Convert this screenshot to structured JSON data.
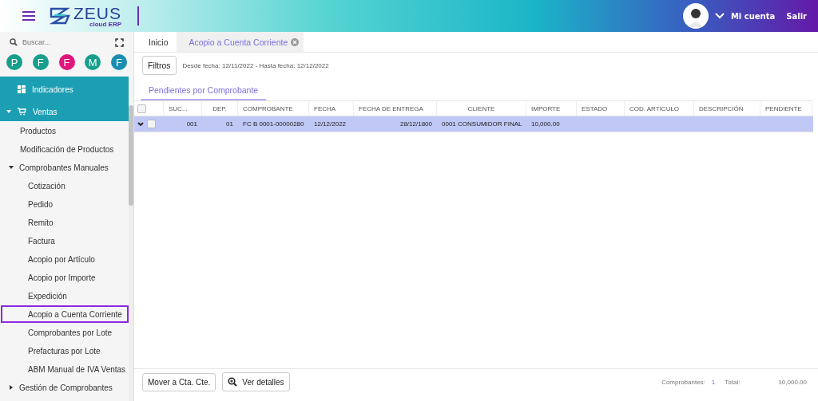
{
  "header": {
    "logo_title": "ZEUS",
    "logo_subtitle": "cloud ERP",
    "account": "Mi cuenta",
    "logout": "Salir"
  },
  "sidebar": {
    "search": {
      "placeholder": "Buscar..."
    },
    "shortcuts": [
      {
        "letter": "P",
        "color": "#179e8c"
      },
      {
        "letter": "F",
        "color": "#179e8c"
      },
      {
        "letter": "F",
        "color": "#e0177d"
      },
      {
        "letter": "M",
        "color": "#179e8c"
      },
      {
        "letter": "F",
        "color": "#1a8db0"
      }
    ],
    "items": [
      {
        "label": "Indicadores",
        "kind": "grid",
        "selected": false
      },
      {
        "label": "Ventas",
        "kind": "cart",
        "expanded": true,
        "selected": false,
        "children": [
          {
            "label": "Productos",
            "selected": false
          },
          {
            "label": "Modificación de Productos",
            "selected": false
          },
          {
            "label": "Comprobantes Manuales",
            "expanded": true,
            "selected": false,
            "children": [
              {
                "label": "Cotización",
                "selected": false
              },
              {
                "label": "Pedido",
                "selected": false
              },
              {
                "label": "Remito",
                "selected": false
              },
              {
                "label": "Factura",
                "selected": false
              },
              {
                "label": "Acopio por Artículo",
                "selected": false
              },
              {
                "label": "Acopio por Importe",
                "selected": false
              },
              {
                "label": "Expedición",
                "selected": false
              },
              {
                "label": "Acopio a Cuenta Corriente",
                "selected": true
              },
              {
                "label": "Comprobantes por Lote",
                "selected": false
              },
              {
                "label": "Prefacturas por Lote",
                "selected": false
              },
              {
                "label": "ABM Manual de IVA Ventas",
                "selected": false
              }
            ]
          },
          {
            "label": "Gestión de Comprobantes",
            "expanded": false,
            "selected": false
          }
        ]
      }
    ]
  },
  "tabs": [
    {
      "label": "Inicio",
      "selected": false,
      "closable": false
    },
    {
      "label": "Acopio a Cuenta Corriente",
      "selected": true,
      "closable": true
    }
  ],
  "filters": {
    "button": "Filtros",
    "summary": "Desde fecha: 12/11/2022 - Hasta fecha: 12/12/2022"
  },
  "subtabs": [
    {
      "label": "Pendientes por Comprobante",
      "selected": true
    }
  ],
  "table": {
    "all_checked": false,
    "columns": [
      "SUC...",
      "DEP.",
      "COMPROBANTE",
      "FECHA",
      "FECHA DE ENTREGA",
      "CLIENTE",
      "IMPORTE",
      "ESTADO",
      "COD. ARTICULO",
      "DESCRIPCIÓN",
      "PENDIENTE"
    ],
    "rows": [
      {
        "selected": true,
        "checked": false,
        "expanded": false,
        "cells": [
          "001",
          "01",
          "FC B 0001-00000280",
          "12/12/2022",
          "28/12/1800",
          "0001 CONSUMIDOR FINAL",
          "10,000.00"
        ]
      }
    ]
  },
  "footer": {
    "buttons": [
      {
        "label": "Mover a Cta. Cte.",
        "kind": "plain"
      },
      {
        "label": "Ver detalles",
        "kind": "zoom"
      }
    ],
    "count_label": "Comprobantes:",
    "count": "1",
    "total_label": "Total:",
    "total": "10,000.00"
  }
}
